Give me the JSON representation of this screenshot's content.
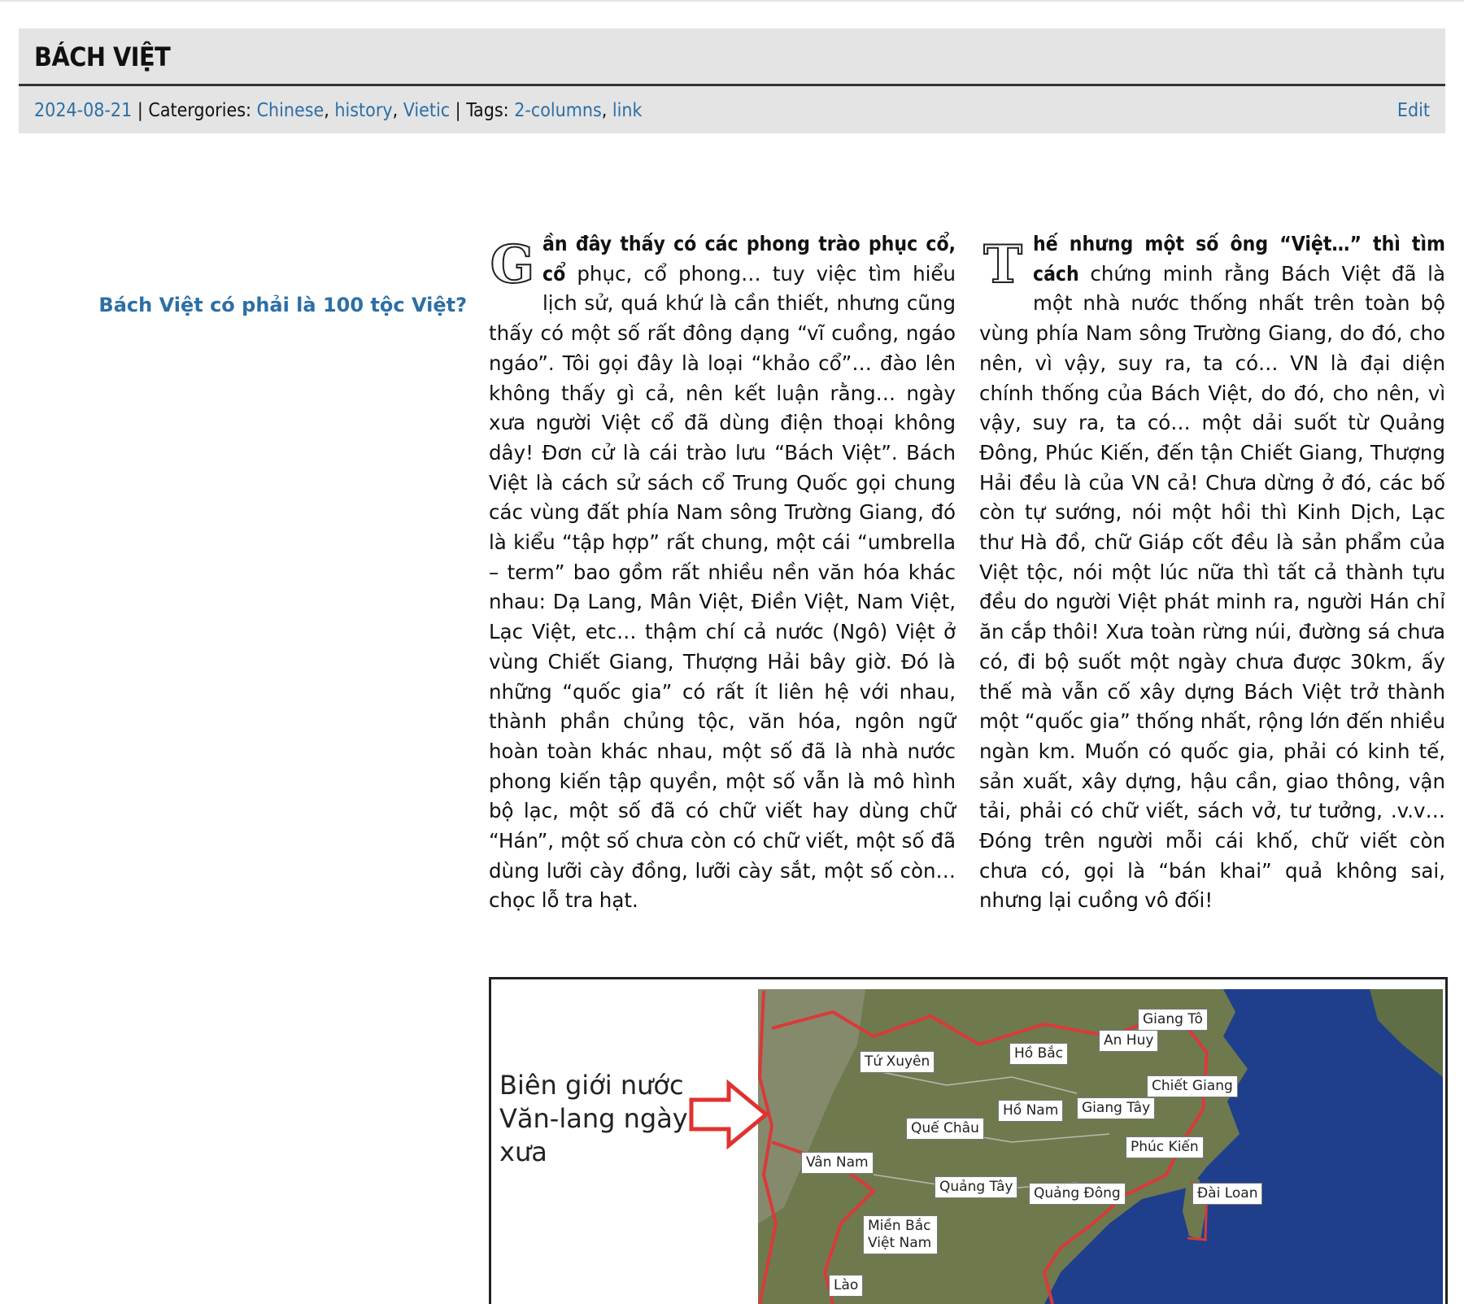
{
  "post": {
    "title": "BÁCH VIỆT",
    "date": "2024-08-21",
    "categories_label": "Catergories:",
    "categories": [
      "Chinese",
      "history",
      "Vietic"
    ],
    "tags_label": "Tags:",
    "tags": [
      "2-columns",
      "link"
    ],
    "edit_label": "Edit"
  },
  "sidebar": {
    "link_text": "Bách Việt có phải là 100 tộc Việt?"
  },
  "article": {
    "left": {
      "dropcap": "G",
      "lead": "ần đây thấy có các phong trào phục cổ, cổ",
      "body": " phục, cổ phong… tuy việc tìm hiểu lịch sử, quá khứ là cần thiết, nhưng cũng thấy có một số rất đông dạng “vĩ cuồng, ngáo ngáo”. Tôi gọi đây là loại “khảo cổ”… đào lên không thấy gì cả, nên kết luận rằng… ngày xưa người Việt cổ đã dùng điện thoại không dây! Đơn cử là cái trào lưu “Bách Việt”. Bách Việt là cách sử sách cổ Trung Quốc gọi chung các vùng đất phía Nam sông Trường Giang, đó là kiểu “tập hợp” rất chung, một cái “umbrella – term” bao gồm rất nhiều nền văn hóa khác nhau: Dạ Lang, Mân Việt, Điền Việt, Nam Việt, Lạc Việt, etc… thậm chí cả nước (Ngô) Việt ở vùng Chiết Giang, Thượng Hải bây giờ. Đó là những “quốc gia” có rất ít liên hệ với nhau, thành phần chủng tộc, văn hóa, ngôn ngữ hoàn toàn khác nhau, một số đã là nhà nước phong kiến tập quyền, một số vẫn là mô hình bộ lạc, một số đã có chữ viết hay dùng chữ “Hán”, một số chưa còn có chữ viết, một số đã dùng lưỡi cày đồng, lưỡi cày sắt, một số còn… chọc lỗ tra hạt."
    },
    "right": {
      "dropcap": "T",
      "lead": "hế nhưng một số ông “Việt…” thì tìm cách",
      "body": " chứng minh rằng Bách Việt đã là một nhà nước thống nhất trên toàn bộ vùng phía Nam sông Trường Giang, do đó, cho nên, vì vậy, suy ra, ta có… VN là đại diện chính thống của Bách Việt, do đó, cho nên, vì vậy, suy ra, ta có… một dải suốt từ Quảng Đông, Phúc Kiến, đến tận Chiết Giang, Thượng Hải đều là của VN cả! Chưa dừng ở đó, các bố còn tự sướng, nói một hồi thì Kinh Dịch, Lạc thư Hà đồ, chữ Giáp cốt đều là sản phẩm của Việt tộc, nói một lúc nữa thì tất cả thành tựu đều do người Việt phát minh ra, người Hán chỉ ăn cắp thôi! Xưa toàn rừng núi, đường sá chưa có, đi bộ suốt một ngày chưa được 30km, ấy thế mà vẫn cố xây dựng Bách Việt trở thành một “quốc gia” thống nhất, rộng lớn đến nhiều ngàn km. Muốn có quốc gia, phải có kinh tế, sản xuất, xây dựng, hậu cần, giao thông, vận tải, phải có chữ viết, sách vở, tư tưởng, .v.v… Đóng trên người mỗi cái khố, chữ viết còn chưa có, gọi là “bán khai” quả không sai, nhưng lại cuồng vô đối!"
    }
  },
  "map": {
    "caption": "Biên giới nước Văn-lang ngày xưa",
    "colors": {
      "land": "#6e7a4e",
      "sea": "#1f3f8c",
      "border": "#d93a3a",
      "arrow": "#e0322f"
    },
    "labels": [
      "Giang Tô",
      "An Huy",
      "Tứ Xuyên",
      "Hồ Bắc",
      "Chiết Giang",
      "Hồ Nam",
      "Giang Tây",
      "Quế Châu",
      "Phúc Kiến",
      "Vân Nam",
      "Quảng Tây",
      "Quảng Đông",
      "Đài Loan",
      "Miền Bắc Việt Nam",
      "Lào"
    ]
  }
}
